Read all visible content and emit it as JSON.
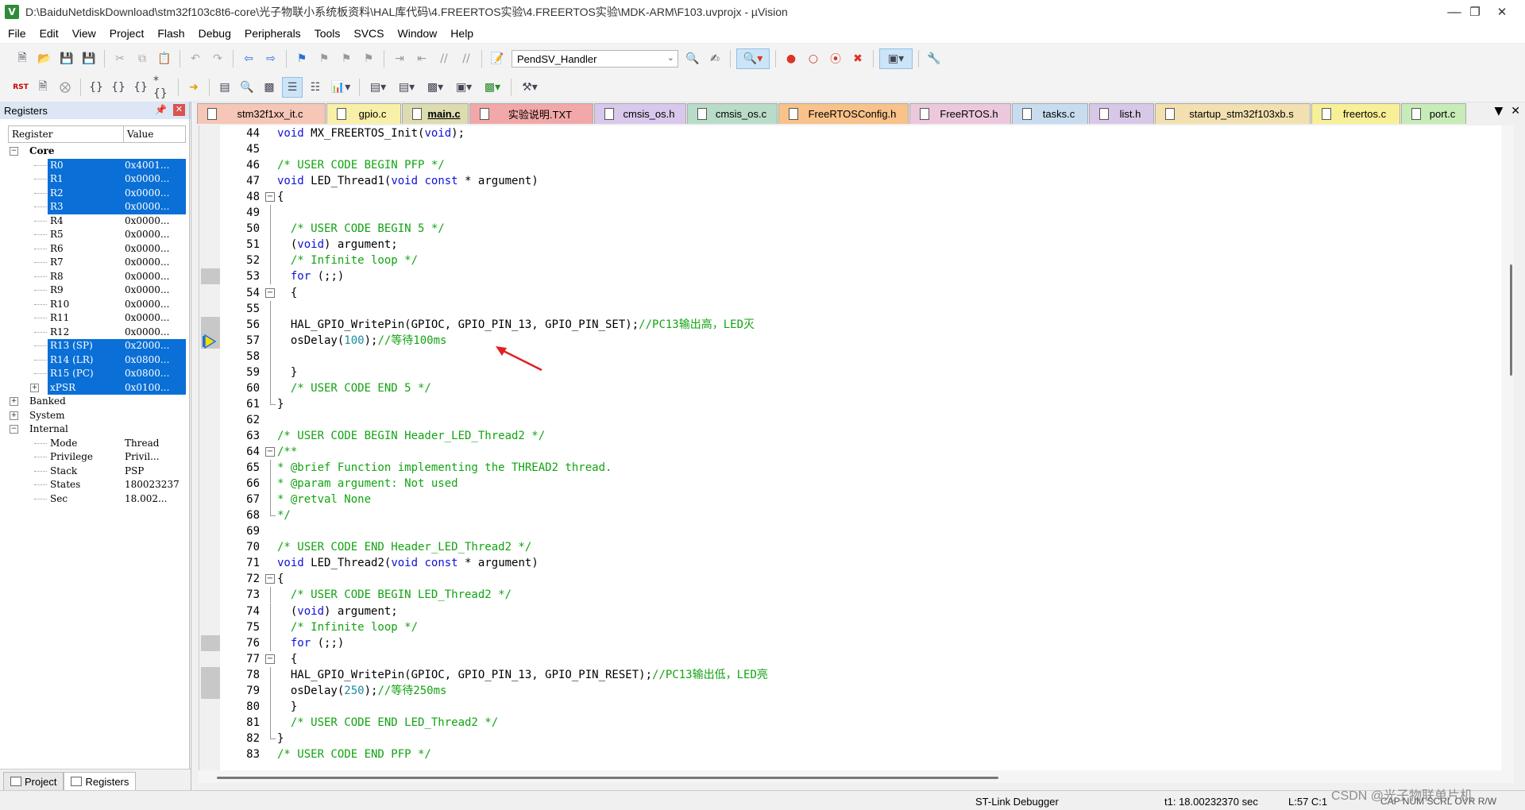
{
  "window": {
    "title": "D:\\BaiduNetdiskDownload\\stm32f103c8t6-core\\光子物联小系统板资料\\HAL库代码\\4.FREERTOS实验\\4.FREERTOS实验\\MDK-ARM\\F103.uvprojx - µVision",
    "app_icon": "V"
  },
  "menu": [
    "File",
    "Edit",
    "View",
    "Project",
    "Flash",
    "Debug",
    "Peripherals",
    "Tools",
    "SVCS",
    "Window",
    "Help"
  ],
  "toolbar": {
    "function_combo": "PendSV_Handler"
  },
  "registers_panel": {
    "title": "Registers",
    "col_register": "Register",
    "col_value": "Value",
    "rows": [
      {
        "name": "Core",
        "value": "",
        "indent": 0,
        "expander": "−",
        "bold": true,
        "hl": false
      },
      {
        "name": "R0",
        "value": "0x4001...",
        "indent": 2,
        "hl": true
      },
      {
        "name": "R1",
        "value": "0x0000...",
        "indent": 2,
        "hl": true
      },
      {
        "name": "R2",
        "value": "0x0000...",
        "indent": 2,
        "hl": true
      },
      {
        "name": "R3",
        "value": "0x0000...",
        "indent": 2,
        "hl": true
      },
      {
        "name": "R4",
        "value": "0x0000...",
        "indent": 2,
        "hl": false
      },
      {
        "name": "R5",
        "value": "0x0000...",
        "indent": 2,
        "hl": false
      },
      {
        "name": "R6",
        "value": "0x0000...",
        "indent": 2,
        "hl": false
      },
      {
        "name": "R7",
        "value": "0x0000...",
        "indent": 2,
        "hl": false
      },
      {
        "name": "R8",
        "value": "0x0000...",
        "indent": 2,
        "hl": false
      },
      {
        "name": "R9",
        "value": "0x0000...",
        "indent": 2,
        "hl": false
      },
      {
        "name": "R10",
        "value": "0x0000...",
        "indent": 2,
        "hl": false
      },
      {
        "name": "R11",
        "value": "0x0000...",
        "indent": 2,
        "hl": false
      },
      {
        "name": "R12",
        "value": "0x0000...",
        "indent": 2,
        "hl": false
      },
      {
        "name": "R13 (SP)",
        "value": "0x2000...",
        "indent": 2,
        "hl": true
      },
      {
        "name": "R14 (LR)",
        "value": "0x0800...",
        "indent": 2,
        "hl": true
      },
      {
        "name": "R15 (PC)",
        "value": "0x0800...",
        "indent": 2,
        "hl": true
      },
      {
        "name": "xPSR",
        "value": "0x0100...",
        "indent": 2,
        "expander": "+",
        "hl": true
      },
      {
        "name": "Banked",
        "value": "",
        "indent": 0,
        "expander": "+",
        "hl": false
      },
      {
        "name": "System",
        "value": "",
        "indent": 0,
        "expander": "+",
        "hl": false
      },
      {
        "name": "Internal",
        "value": "",
        "indent": 0,
        "expander": "−",
        "hl": false
      },
      {
        "name": "Mode",
        "value": "Thread",
        "indent": 2,
        "hl": false
      },
      {
        "name": "Privilege",
        "value": "Privil...",
        "indent": 2,
        "hl": false
      },
      {
        "name": "Stack",
        "value": "PSP",
        "indent": 2,
        "hl": false
      },
      {
        "name": "States",
        "value": "180023237",
        "indent": 2,
        "hl": false
      },
      {
        "name": "Sec",
        "value": "18.002...",
        "indent": 2,
        "hl": false
      }
    ]
  },
  "left_bottom_tabs": [
    {
      "label": "Project",
      "active": false
    },
    {
      "label": "Registers",
      "active": true
    }
  ],
  "file_tabs": [
    {
      "label": "stm32f1xx_it.c",
      "color": "#f6c6b6",
      "active": false
    },
    {
      "label": "gpio.c",
      "color": "#f8f0a8",
      "active": false
    },
    {
      "label": "main.c",
      "color": "#dcdcb0",
      "active": true
    },
    {
      "label": "实验说明.TXT",
      "color": "#f2a8a8",
      "active": false
    },
    {
      "label": "cmsis_os.h",
      "color": "#d8c8ec",
      "active": false
    },
    {
      "label": "cmsis_os.c",
      "color": "#b8dcc8",
      "active": false
    },
    {
      "label": "FreeRTOSConfig.h",
      "color": "#f9c28a",
      "active": false
    },
    {
      "label": "FreeRTOS.h",
      "color": "#ecc8dc",
      "active": false
    },
    {
      "label": "tasks.c",
      "color": "#c8dcf0",
      "active": false
    },
    {
      "label": "list.h",
      "color": "#d8c8e8",
      "active": false
    },
    {
      "label": "startup_stm32f103xb.s",
      "color": "#f2e0b0",
      "active": false
    },
    {
      "label": "freertos.c",
      "color": "#f8f098",
      "active": false
    },
    {
      "label": "port.c",
      "color": "#c8ecb8",
      "active": false
    }
  ],
  "code_lines": [
    {
      "n": "44",
      "fold": "",
      "parts": [
        [
          "k",
          "void"
        ],
        [
          "",
          "MX_FREERTOS_Init("
        ],
        [
          "k",
          "void"
        ],
        [
          "",
          ");"
        ]
      ]
    },
    {
      "n": "45",
      "fold": "",
      "parts": []
    },
    {
      "n": "46",
      "fold": "",
      "parts": [
        [
          "c",
          "/* USER CODE BEGIN PFP */"
        ]
      ]
    },
    {
      "n": "47",
      "fold": "",
      "parts": [
        [
          "k",
          "void"
        ],
        [
          "",
          "LED_Thread1("
        ],
        [
          "k",
          "void const"
        ],
        [
          "",
          "* argument)"
        ]
      ]
    },
    {
      "n": "48",
      "fold": "box",
      "parts": [
        [
          "",
          "{"
        ]
      ]
    },
    {
      "n": "49",
      "fold": "line",
      "parts": []
    },
    {
      "n": "50",
      "fold": "line",
      "parts": [
        [
          "c",
          "  /* USER CODE BEGIN 5 */"
        ]
      ]
    },
    {
      "n": "51",
      "fold": "line",
      "parts": [
        [
          "",
          "  ("
        ],
        [
          "k",
          "void"
        ],
        [
          "",
          ") argument;"
        ]
      ]
    },
    {
      "n": "52",
      "fold": "line",
      "parts": [
        [
          "c",
          "  /* Infinite loop */"
        ]
      ]
    },
    {
      "n": "53",
      "fold": "line",
      "parts": [
        [
          "k",
          "  for"
        ],
        [
          "",
          "(;;)"
        ]
      ]
    },
    {
      "n": "54",
      "fold": "box",
      "parts": [
        [
          "",
          "  {"
        ]
      ]
    },
    {
      "n": "55",
      "fold": "line",
      "parts": []
    },
    {
      "n": "56",
      "fold": "line",
      "parts": [
        [
          "",
          "  HAL_GPIO_WritePin(GPIOC, GPIO_PIN_13, GPIO_PIN_SET);"
        ],
        [
          "c",
          "//PC13输出高，LED灭"
        ]
      ]
    },
    {
      "n": "57",
      "fold": "line",
      "parts": [
        [
          "",
          "  osDelay("
        ],
        [
          "n",
          "100"
        ],
        [
          "",
          ");"
        ],
        [
          "c",
          "//等待100ms"
        ]
      ]
    },
    {
      "n": "58",
      "fold": "line",
      "parts": []
    },
    {
      "n": "59",
      "fold": "line",
      "parts": [
        [
          "",
          "  }"
        ]
      ]
    },
    {
      "n": "60",
      "fold": "line",
      "parts": [
        [
          "c",
          "  /* USER CODE END 5 */"
        ]
      ]
    },
    {
      "n": "61",
      "fold": "end",
      "parts": [
        [
          "",
          "}"
        ]
      ]
    },
    {
      "n": "62",
      "fold": "",
      "parts": []
    },
    {
      "n": "63",
      "fold": "",
      "parts": [
        [
          "c",
          "/* USER CODE BEGIN Header_LED_Thread2 */"
        ]
      ]
    },
    {
      "n": "64",
      "fold": "box",
      "parts": [
        [
          "c",
          "/**"
        ]
      ]
    },
    {
      "n": "65",
      "fold": "line",
      "parts": [
        [
          "c",
          "* @brief Function implementing the THREAD2 thread."
        ]
      ]
    },
    {
      "n": "66",
      "fold": "line",
      "parts": [
        [
          "c",
          "* @param argument: Not used"
        ]
      ]
    },
    {
      "n": "67",
      "fold": "line",
      "parts": [
        [
          "c",
          "* @retval None"
        ]
      ]
    },
    {
      "n": "68",
      "fold": "end",
      "parts": [
        [
          "c",
          "*/"
        ]
      ]
    },
    {
      "n": "69",
      "fold": "",
      "parts": []
    },
    {
      "n": "70",
      "fold": "",
      "parts": [
        [
          "c",
          "/* USER CODE END Header_LED_Thread2 */"
        ]
      ]
    },
    {
      "n": "71",
      "fold": "",
      "parts": [
        [
          "k",
          "void"
        ],
        [
          "",
          "LED_Thread2("
        ],
        [
          "k",
          "void const"
        ],
        [
          "",
          "* argument)"
        ]
      ]
    },
    {
      "n": "72",
      "fold": "box",
      "parts": [
        [
          "",
          "{"
        ]
      ]
    },
    {
      "n": "73",
      "fold": "line",
      "parts": [
        [
          "c",
          "  /* USER CODE BEGIN LED_Thread2 */"
        ]
      ]
    },
    {
      "n": "74",
      "fold": "line",
      "parts": [
        [
          "",
          "  ("
        ],
        [
          "k",
          "void"
        ],
        [
          "",
          ") argument;"
        ]
      ]
    },
    {
      "n": "75",
      "fold": "line",
      "parts": [
        [
          "c",
          "  /* Infinite loop */"
        ]
      ]
    },
    {
      "n": "76",
      "fold": "line",
      "parts": [
        [
          "k",
          "  for"
        ],
        [
          "",
          "(;;)"
        ]
      ]
    },
    {
      "n": "77",
      "fold": "box",
      "parts": [
        [
          "",
          "  {"
        ]
      ]
    },
    {
      "n": "78",
      "fold": "line",
      "parts": [
        [
          "",
          "  HAL_GPIO_WritePin(GPIOC, GPIO_PIN_13, GPIO_PIN_RESET);"
        ],
        [
          "c",
          "//PC13输出低，LED亮"
        ]
      ]
    },
    {
      "n": "79",
      "fold": "line",
      "parts": [
        [
          "",
          "  osDelay("
        ],
        [
          "n",
          "250"
        ],
        [
          "",
          ");"
        ],
        [
          "c",
          "//等待250ms"
        ]
      ]
    },
    {
      "n": "80",
      "fold": "line",
      "parts": [
        [
          "",
          "  }"
        ]
      ]
    },
    {
      "n": "81",
      "fold": "line",
      "parts": [
        [
          "c",
          "  /* USER CODE END LED_Thread2 */"
        ]
      ]
    },
    {
      "n": "82",
      "fold": "end",
      "parts": [
        [
          "",
          "}"
        ]
      ]
    },
    {
      "n": "83",
      "fold": "",
      "parts": [
        [
          "c",
          "/* USER CODE END PFP */"
        ]
      ]
    }
  ],
  "status": {
    "debugger": "ST-Link Debugger",
    "time": "t1: 18.00232370 sec",
    "cursor": "L:57 C:1",
    "indicators": "CAP  NUM  SCRL  OVR  R/W"
  },
  "watermark": "CSDN @光子物联单片机"
}
